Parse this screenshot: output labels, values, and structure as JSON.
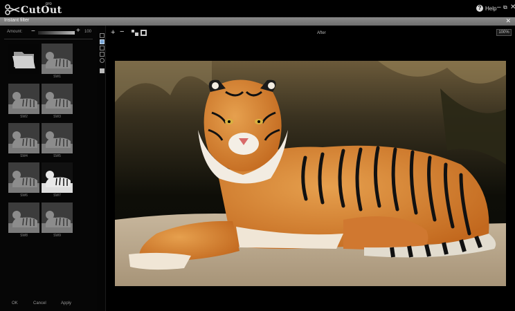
{
  "app": {
    "logo_text": "CutOut",
    "logo_badge": "pro",
    "help_label": "Help",
    "win_minimize": "–",
    "win_restore": "⧉",
    "win_close": "✕"
  },
  "dialog": {
    "title": "Instant filter",
    "close": "✕"
  },
  "amount": {
    "label": "Amount:",
    "minus": "−",
    "plus": "+",
    "value": "100",
    "fill_fraction": 1.0
  },
  "thumbnails": [
    {
      "label": "",
      "kind": "folder"
    },
    {
      "label": "SW1",
      "kind": "tiger-gray"
    },
    {
      "label": "SW2",
      "kind": "tiger-gray"
    },
    {
      "label": "SW3",
      "kind": "tiger-gray"
    },
    {
      "label": "SW4",
      "kind": "tiger-gray"
    },
    {
      "label": "SW5",
      "kind": "tiger-gray"
    },
    {
      "label": "SW6",
      "kind": "tiger-gray"
    },
    {
      "label": "SW7",
      "kind": "tiger-contrast"
    },
    {
      "label": "SW8",
      "kind": "tiger-gray"
    },
    {
      "label": "SW9",
      "kind": "tiger-gray"
    }
  ],
  "buttons": {
    "ok": "OK",
    "cancel": "Cancel",
    "apply": "Apply"
  },
  "viewer": {
    "zoom_in": "+",
    "zoom_out": "−",
    "view_label": "After",
    "zoom_level": "100%"
  },
  "colors": {
    "header_gray": "#7a7a7a",
    "panel_bg": "#060606",
    "tiger_orange": "#d9822b"
  }
}
